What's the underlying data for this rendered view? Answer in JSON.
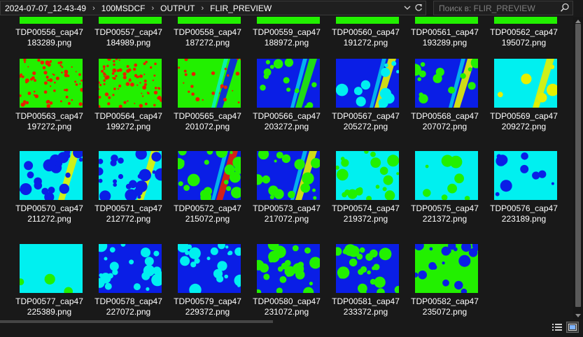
{
  "breadcrumb": [
    "2024-07-07_12-43-49",
    "100MSDCF",
    "OUTPUT",
    "FLIR_PREVIEW"
  ],
  "search": {
    "placeholder": "Поиск в: FLIR_PREVIEW"
  },
  "files": [
    {
      "line1": "TDP00556_cap47",
      "line2": "183289.png"
    },
    {
      "line1": "TDP00557_cap47",
      "line2": "184989.png"
    },
    {
      "line1": "TDP00558_cap47",
      "line2": "187272.png"
    },
    {
      "line1": "TDP00559_cap47",
      "line2": "188972.png"
    },
    {
      "line1": "TDP00560_cap47",
      "line2": "191272.png"
    },
    {
      "line1": "TDP00561_cap47",
      "line2": "193289.png"
    },
    {
      "line1": "TDP00562_cap47",
      "line2": "195072.png"
    },
    {
      "line1": "TDP00563_cap47",
      "line2": "197272.png"
    },
    {
      "line1": "TDP00564_cap47",
      "line2": "199272.png"
    },
    {
      "line1": "TDP00565_cap47",
      "line2": "201072.png"
    },
    {
      "line1": "TDP00566_cap47",
      "line2": "203272.png"
    },
    {
      "line1": "TDP00567_cap47",
      "line2": "205272.png"
    },
    {
      "line1": "TDP00568_cap47",
      "line2": "207072.png"
    },
    {
      "line1": "TDP00569_cap47",
      "line2": "209272.png"
    },
    {
      "line1": "TDP00570_cap47",
      "line2": "211272.png"
    },
    {
      "line1": "TDP00571_cap47",
      "line2": "212772.png"
    },
    {
      "line1": "TDP00572_cap47",
      "line2": "215072.png"
    },
    {
      "line1": "TDP00573_cap47",
      "line2": "217072.png"
    },
    {
      "line1": "TDP00574_cap47",
      "line2": "219372.png"
    },
    {
      "line1": "TDP00575_cap47",
      "line2": "221372.png"
    },
    {
      "line1": "TDP00576_cap47",
      "line2": "223189.png"
    },
    {
      "line1": "TDP00577_cap47",
      "line2": "225389.png"
    },
    {
      "line1": "TDP00578_cap47",
      "line2": "227072.png"
    },
    {
      "line1": "TDP00579_cap47",
      "line2": "229372.png"
    },
    {
      "line1": "TDP00580_cap47",
      "line2": "231072.png"
    },
    {
      "line1": "TDP00581_cap47",
      "line2": "233372.png"
    },
    {
      "line1": "TDP00582_cap47",
      "line2": "235072.png"
    }
  ],
  "colors": {
    "background": "#191919",
    "text": "#ffffff",
    "palette_blue": "#0a1ee6",
    "palette_green": "#22f000",
    "palette_cyan": "#00f0f0",
    "palette_red": "#e82000",
    "palette_yellow": "#e6f000"
  },
  "icons": {
    "crumb_separator": "chevron-right-icon",
    "address_dropdown": "chevron-down-icon",
    "refresh": "refresh-icon",
    "search": "search-icon",
    "details_view": "details-view-icon",
    "large_icons_view": "large-icons-view-icon"
  }
}
